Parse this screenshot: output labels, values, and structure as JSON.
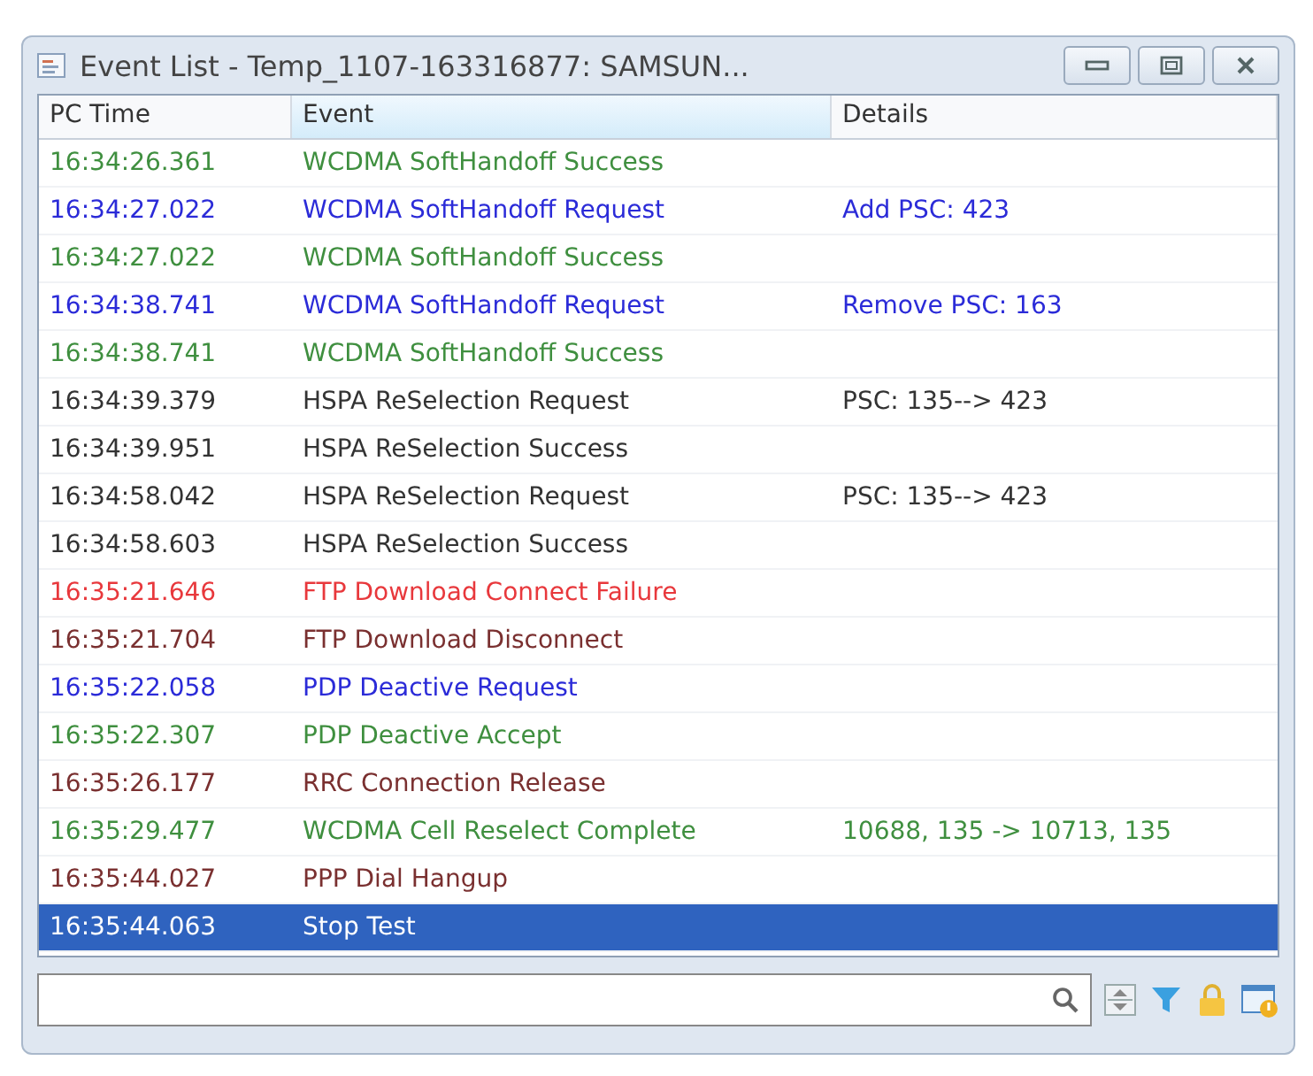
{
  "window": {
    "title": "Event List - Temp_1107-163316877: SAMSUN..."
  },
  "table": {
    "columns": [
      "PC Time",
      "Event",
      "Details"
    ],
    "rows": [
      {
        "time": "16:34:26.361",
        "event": "WCDMA SoftHandoff Success",
        "color": "#3f8f3f",
        "selected": false
      },
      {
        "time": "16:34:27.022",
        "event": "WCDMA SoftHandoff Request",
        "details": "Add PSC: 423",
        "color": "#2b2bd8",
        "selected": false
      },
      {
        "time": "16:34:27.022",
        "event": "WCDMA SoftHandoff Success",
        "color": "#3f8f3f",
        "selected": false
      },
      {
        "time": "16:34:38.741",
        "event": "WCDMA SoftHandoff Request",
        "details": "Remove PSC: 163",
        "color": "#2b2bd8",
        "selected": false
      },
      {
        "time": "16:34:38.741",
        "event": "WCDMA SoftHandoff Success",
        "color": "#3f8f3f",
        "selected": false
      },
      {
        "time": "16:34:39.379",
        "event": "HSPA ReSelection Request",
        "details": "PSC: 135--> 423",
        "color": "#333333",
        "selected": false
      },
      {
        "time": "16:34:39.951",
        "event": "HSPA ReSelection Success",
        "color": "#333333",
        "selected": false
      },
      {
        "time": "16:34:58.042",
        "event": "HSPA ReSelection Request",
        "details": "PSC: 135--> 423",
        "color": "#333333",
        "selected": false
      },
      {
        "time": "16:34:58.603",
        "event": "HSPA ReSelection Success",
        "color": "#333333",
        "selected": false
      },
      {
        "time": "16:35:21.646",
        "event": "FTP Download Connect Failure",
        "color": "#e8383c",
        "selected": false
      },
      {
        "time": "16:35:21.704",
        "event": "FTP Download Disconnect",
        "color": "#7a3030",
        "selected": false
      },
      {
        "time": "16:35:22.058",
        "event": "PDP Deactive Request",
        "color": "#2b2bd8",
        "selected": false
      },
      {
        "time": "16:35:22.307",
        "event": "PDP Deactive Accept",
        "color": "#3f8f3f",
        "selected": false
      },
      {
        "time": "16:35:26.177",
        "event": "RRC Connection Release",
        "color": "#7a3030",
        "selected": false
      },
      {
        "time": "16:35:29.477",
        "event": "WCDMA Cell Reselect Complete",
        "details": "10688, 135 -> 10713, 135",
        "color": "#3f8f3f",
        "selected": false
      },
      {
        "time": "16:35:44.027",
        "event": "PPP Dial Hangup",
        "color": "#7a3030",
        "selected": false
      },
      {
        "time": "16:35:44.063",
        "event": "Stop Test",
        "selected": true
      }
    ]
  }
}
